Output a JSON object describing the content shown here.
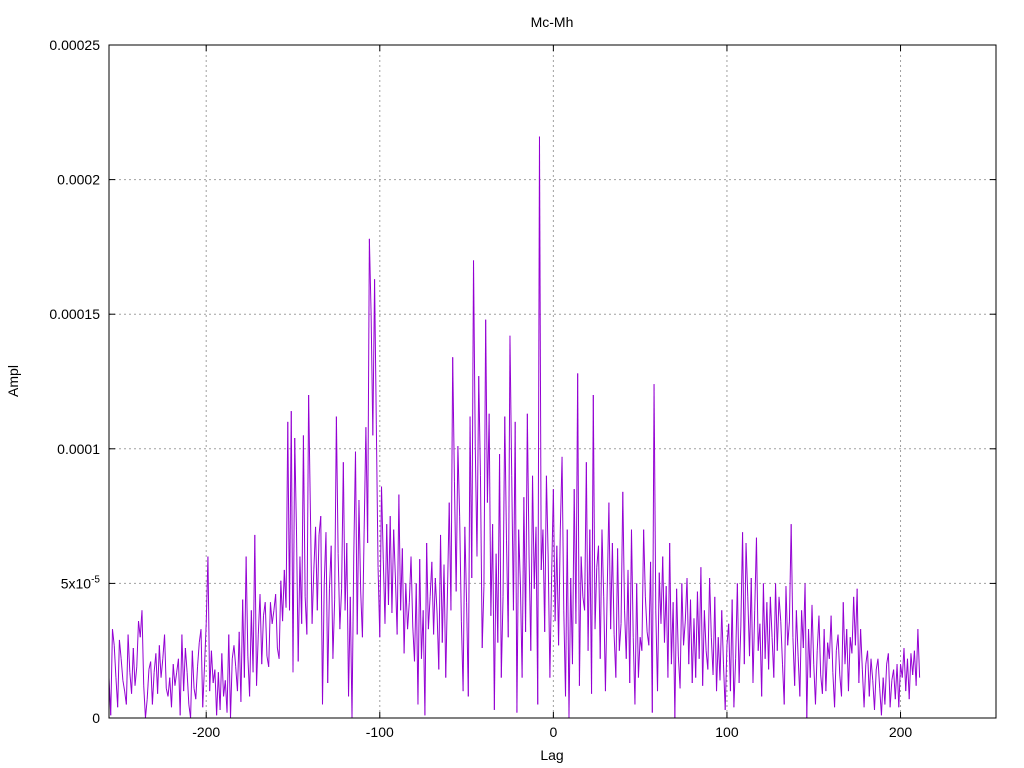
{
  "chart_data": {
    "type": "line",
    "title": "Mc-Mh",
    "xlabel": "Lag",
    "ylabel": "Ampl",
    "xlim": [
      -256,
      255
    ],
    "ylim": [
      0,
      0.00025
    ],
    "grid": true,
    "legend": "none",
    "x_ticks": [
      {
        "value": -200,
        "label": "-200"
      },
      {
        "value": -100,
        "label": "-100"
      },
      {
        "value": 0,
        "label": "0"
      },
      {
        "value": 100,
        "label": "100"
      },
      {
        "value": 200,
        "label": "200"
      }
    ],
    "y_ticks": [
      {
        "value": 0,
        "label": "0"
      },
      {
        "value": 5e-05,
        "label": "5x10",
        "sup": "-5"
      },
      {
        "value": 0.0001,
        "label": "0.0001"
      },
      {
        "value": 0.00015,
        "label": "0.00015"
      },
      {
        "value": 0.0002,
        "label": "0.0002"
      },
      {
        "value": 0.00025,
        "label": "0.00025"
      }
    ],
    "series": [
      {
        "color": "#9400d3",
        "x_start": -256,
        "x_step": 1,
        "values": [
          1.5e-05,
          1e-06,
          3.3e-05,
          2.7e-05,
          1.5e-05,
          4e-06,
          2.9e-05,
          2.2e-05,
          1.4e-05,
          1e-05,
          5e-06,
          3.1e-05,
          1.7e-05,
          9e-06,
          2.6e-05,
          1.2e-05,
          1.9e-05,
          3.6e-05,
          3e-05,
          4e-05,
          1.2e-05,
          0.0,
          7e-06,
          1.8e-05,
          2.1e-05,
          5e-06,
          1.7e-05,
          2.4e-05,
          9e-06,
          2.7e-05,
          1.5e-05,
          2.2e-05,
          3.1e-05,
          1.1e-05,
          8e-06,
          1.5e-05,
          4e-06,
          2e-05,
          1.2e-05,
          1.7e-05,
          2.2e-05,
          1e-06,
          3.1e-05,
          1e-05,
          2.6e-05,
          1.7e-05,
          5e-06,
          0.0,
          2.5e-05,
          1.1e-05,
          7e-06,
          1.9e-05,
          2.8e-05,
          3.3e-05,
          4e-06,
          1.9e-05,
          3.5e-05,
          6e-05,
          1e-05,
          2.5e-05,
          1.3e-05,
          1.8e-05,
          1e-06,
          1.7e-05,
          3e-06,
          2.4e-05,
          8e-06,
          1.4e-05,
          2e-06,
          3.1e-05,
          0.0,
          2.2e-05,
          2.7e-05,
          1.9e-05,
          1e-05,
          3.2e-05,
          6e-06,
          4.4e-05,
          1.5e-05,
          6e-05,
          2.3e-05,
          8e-06,
          4e-05,
          1.7e-05,
          6.8e-05,
          1.2e-05,
          3.1e-05,
          4.6e-05,
          2e-05,
          3.8e-05,
          4.3e-05,
          2.3e-05,
          1.9e-05,
          4.3e-05,
          3.5e-05,
          4e-05,
          4.6e-05,
          2.6e-05,
          2.2e-05,
          5.1e-05,
          3.6e-05,
          5.5e-05,
          4.1e-05,
          0.00011,
          4e-05,
          0.000114,
          1.7e-05,
          0.000104,
          7e-05,
          2.1e-05,
          6e-05,
          3.5e-05,
          0.000105,
          4.5e-05,
          3.1e-05,
          0.00012,
          7.8e-05,
          3.5e-05,
          5.5e-05,
          7.1e-05,
          4e-05,
          6.8e-05,
          7.5e-05,
          5e-06,
          5e-05,
          6.9e-05,
          1.3e-05,
          4.8e-05,
          6.4e-05,
          2.2e-05,
          4.4e-05,
          0.000112,
          6.1e-05,
          3.3e-05,
          4.8e-05,
          9.5e-05,
          4e-05,
          6.5e-05,
          8e-06,
          4.5e-05,
          0.0,
          6e-05,
          9.9e-05,
          3.1e-05,
          8.1e-05,
          4.7e-05,
          3e-05,
          7e-05,
          0.000108,
          6.5e-05,
          0.000178,
          0.00015,
          0.000105,
          0.000163,
          0.000109,
          5.6e-05,
          3e-05,
          8.6e-05,
          5.9e-05,
          3.5e-05,
          7.2e-05,
          4.2e-05,
          7.5e-05,
          3.9e-05,
          7e-05,
          5.2e-05,
          3.1e-05,
          8.3e-05,
          4e-05,
          6.3e-05,
          2.4e-05,
          5e-05,
          3.3e-05,
          4.3e-05,
          6e-05,
          3.4e-05,
          2.1e-05,
          5e-05,
          5e-06,
          5.9e-05,
          2.2e-05,
          4e-05,
          1e-06,
          6.5e-05,
          3.3e-05,
          4.5e-05,
          5.8e-05,
          3.1e-05,
          5.2e-05,
          3.9e-05,
          1.8e-05,
          6.8e-05,
          2.8e-05,
          5.7e-05,
          1.5e-05,
          4.7e-05,
          8e-05,
          4e-05,
          0.000134,
          8.8e-05,
          4.7e-05,
          0.000101,
          7.5e-05,
          3.6e-05,
          1e-05,
          7.1e-05,
          4.3e-05,
          8e-06,
          0.000112,
          5.2e-05,
          0.00017,
          0.000101,
          6e-05,
          0.000127,
          9e-05,
          2.6e-05,
          4.9e-05,
          0.000148,
          8e-05,
          0.000113,
          3.8e-05,
          7.2e-05,
          3e-06,
          6.1e-05,
          2.8e-05,
          9.8e-05,
          1.5e-05,
          4.5e-05,
          0.000112,
          6.6e-05,
          3e-05,
          0.000142,
          9e-05,
          4e-05,
          0.00011,
          2e-06,
          7e-05,
          5e-05,
          1.5e-05,
          8.2e-05,
          3.2e-05,
          0.000113,
          6e-05,
          2.5e-05,
          9e-05,
          4.8e-05,
          7.1e-05,
          5e-06,
          0.000216,
          5.5e-05,
          7e-05,
          3.2e-05,
          9e-05,
          6e-05,
          1.5e-05,
          5.3e-05,
          8.5e-05,
          3.6e-05,
          6.4e-05,
          2.7e-05,
          7e-05,
          9.7e-05,
          4e-05,
          8e-06,
          7e-05,
          0.0,
          5.2e-05,
          2e-05,
          8.5e-05,
          3.5e-05,
          0.000128,
          1.2e-05,
          6e-05,
          4.5e-05,
          4e-05,
          9.5e-05,
          2.5e-05,
          7e-05,
          9e-06,
          0.00012,
          3.3e-05,
          5.6e-05,
          6.4e-05,
          2.2e-05,
          7e-05,
          4.5e-05,
          1e-05,
          4.7e-05,
          8e-05,
          3.3e-05,
          6.5e-05,
          3.1e-05,
          1.5e-05,
          6.3e-05,
          2.5e-05,
          3.5e-05,
          8.4e-05,
          4e-05,
          2.2e-05,
          5.5e-05,
          1.3e-05,
          7e-05,
          3e-05,
          5e-06,
          5e-05,
          1.5e-05,
          3e-05,
          2.5e-05,
          7e-05,
          4.5e-05,
          3.2e-05,
          2.7e-05,
          5.8e-05,
          2e-06,
          0.000124,
          4e-05,
          1e-05,
          5.4e-05,
          3.5e-05,
          6e-05,
          2.8e-05,
          4.9e-05,
          1.5e-05,
          6.5e-05,
          2e-05,
          4.3e-05,
          0.0,
          4.8e-05,
          2.3e-05,
          1.1e-05,
          5e-05,
          2.7e-05,
          3.6e-05,
          5.2e-05,
          2e-05,
          4.4e-05,
          1.3e-05,
          3.7e-05,
          1.5e-05,
          4.7e-05,
          2.2e-05,
          5.6e-05,
          1.2e-05,
          4e-05,
          2.5e-05,
          1.8e-05,
          5.2e-05,
          3e-05,
          1.6e-05,
          4.5e-05,
          1e-05,
          3e-05,
          1.4e-05,
          4e-05,
          2e-05,
          3e-06,
          2.7e-05,
          3.5e-05,
          1e-05,
          4.4e-05,
          4e-06,
          2.2e-05,
          5e-05,
          1.3e-05,
          3.4e-05,
          6.9e-05,
          2e-05,
          6.5e-05,
          4.5e-05,
          2.3e-05,
          5.2e-05,
          1.3e-05,
          4e-05,
          6.7e-05,
          2.5e-05,
          3.5e-05,
          8e-06,
          5e-05,
          2.2e-05,
          4.3e-05,
          1.8e-05,
          4.5e-05,
          3e-05,
          1.5e-05,
          5e-05,
          2.5e-05,
          4.5e-05,
          3.6e-05,
          2e-05,
          5e-06,
          4.9e-05,
          2.7e-05,
          3.6e-05,
          7.2e-05,
          3e-05,
          1.2e-05,
          4e-05,
          2.3e-05,
          8e-06,
          4e-05,
          2.6e-05,
          5e-05,
          0.0,
          3.3e-05,
          1.5e-05,
          4.2e-05,
          2e-05,
          5e-06,
          2.5e-05,
          3.8e-05,
          1.6e-05,
          9e-06,
          3.3e-05,
          1e-05,
          2.8e-05,
          2.2e-05,
          3.8e-05,
          1.7e-05,
          4e-06,
          2.5e-05,
          3.1e-05,
          1.6e-05,
          8e-06,
          4.3e-05,
          2e-05,
          3.3e-05,
          1e-05,
          3e-05,
          2.4e-05,
          4.5e-05,
          2.7e-05,
          4.8e-05,
          1.3e-05,
          3.3e-05,
          1.8e-05,
          4e-06,
          2e-05,
          2.5e-05,
          8e-06,
          2.2e-05,
          1.4e-05,
          3e-06,
          1.8e-05,
          2.2e-05,
          1.1e-05,
          1e-06,
          1.5e-05,
          5e-06,
          2e-05,
          2.4e-05,
          4e-06,
          1.4e-05,
          1.8e-05,
          7e-06,
          2e-05,
          4e-06,
          2e-05,
          1.5e-05,
          2.6e-05,
          1e-05,
          2.2e-05,
          7e-06,
          2.4e-05,
          1.6e-05,
          2.5e-05,
          1.2e-05,
          3.3e-05,
          1.5e-05
        ]
      }
    ]
  }
}
